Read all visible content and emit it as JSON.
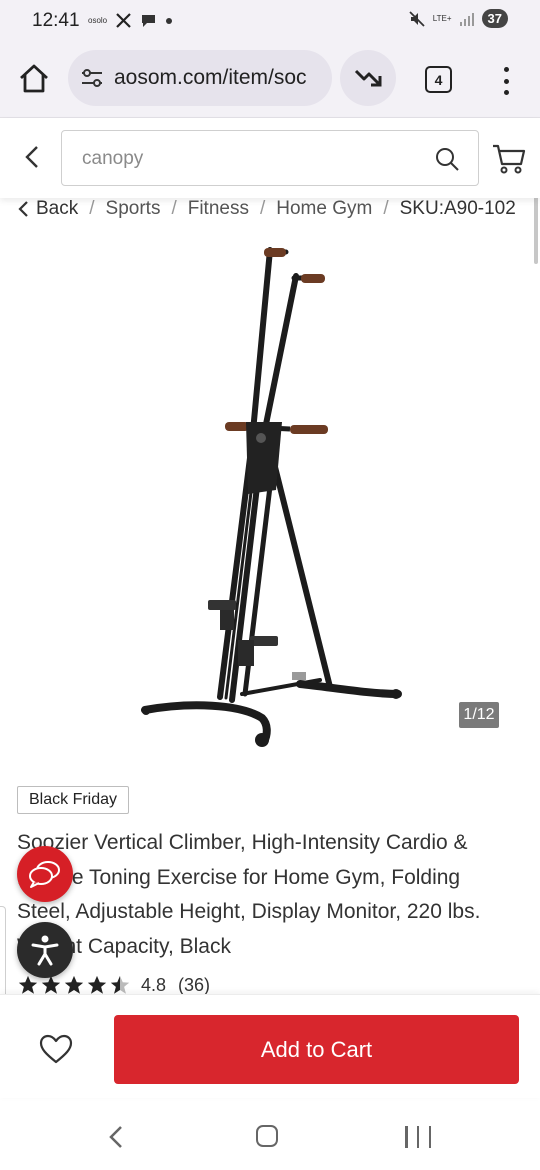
{
  "status_bar": {
    "time": "12:41",
    "carrier_label": "osolo",
    "network": "LTE+",
    "battery": "37",
    "icons": [
      "x-logo-icon",
      "chat-bubble-icon",
      "dot-icon",
      "mute-icon",
      "signal-icon"
    ]
  },
  "browser": {
    "url": "aosom.com/item/soc",
    "tab_count": "4",
    "icons": [
      "home-icon",
      "site-settings-icon",
      "price-trend-icon",
      "more-vert-icon"
    ]
  },
  "search": {
    "placeholder": "canopy",
    "icons": [
      "back-chevron-icon",
      "search-icon",
      "cart-icon"
    ]
  },
  "breadcrumb": {
    "back_label": "Back",
    "items": [
      "Sports",
      "Fitness",
      "Home Gym"
    ],
    "sku": "SKU:A90-102",
    "separator": "/"
  },
  "gallery": {
    "counter": "1/12",
    "image_subject": "vertical-climber-machine"
  },
  "product": {
    "badge": "Black Friday",
    "title": "Soozier Vertical Climber, High-Intensity Cardio & Muscle Toning Exercise for Home Gym, Folding Steel, Adjustable Height, Display Monitor, 220 lbs. Weight Capacity, Black",
    "rating": "4.8",
    "review_count": "(36)",
    "stars": 4.5
  },
  "actions": {
    "add_to_cart": "Add to Cart",
    "accent_color": "#d8262d"
  },
  "floating": {
    "chat_color": "#d61f26",
    "accessibility_color": "#2b2b2b"
  }
}
